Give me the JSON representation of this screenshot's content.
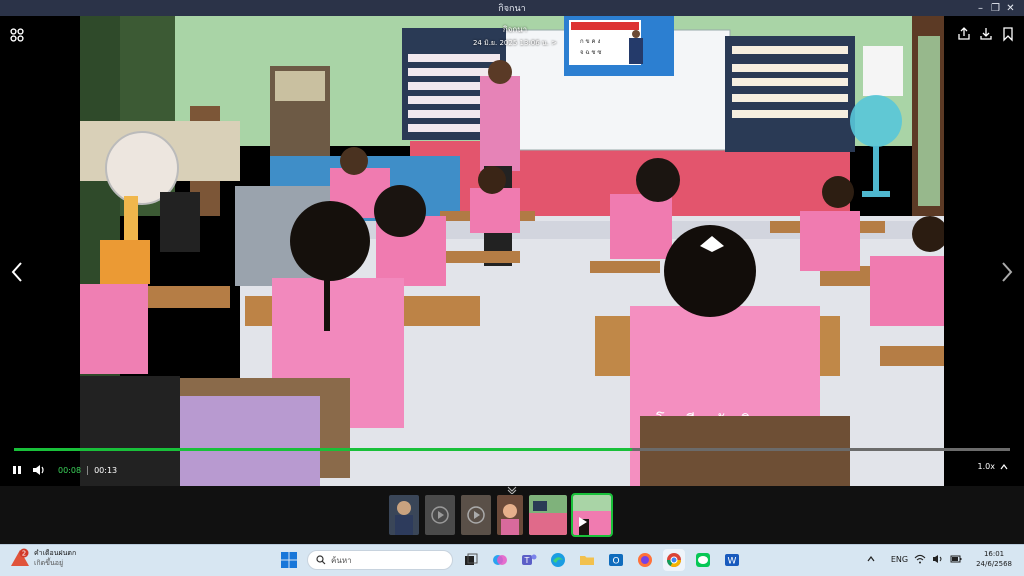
{
  "window": {
    "title": "กิจกนา"
  },
  "viewer": {
    "header_title": "กิจกนา",
    "header_date": "24 มิ.ย. 2025 13:06 น.",
    "date_chevron": ">",
    "progress_fraction": 0.62,
    "time_current": "00:08",
    "time_total": "00:13",
    "speed": "1.0x",
    "photo_text": {
      "shirt": "โรงเรียนวัดเนินสูง",
      "tv_rows": [
        "ก ข ค ง",
        "จ ฉ ช ซ"
      ]
    }
  },
  "taskbar": {
    "weather_badge": "2",
    "weather_title": "คำเตือนฝนตก",
    "weather_sub": "เกิดขึ้นอยู่",
    "search_placeholder": "ค้นหา",
    "lang": "ENG",
    "time": "16:01",
    "date": "24/6/2568"
  },
  "colors": {
    "accent": "#19c03a",
    "taskbar": "#d7e6f2",
    "titlebar": "#2b3348"
  }
}
